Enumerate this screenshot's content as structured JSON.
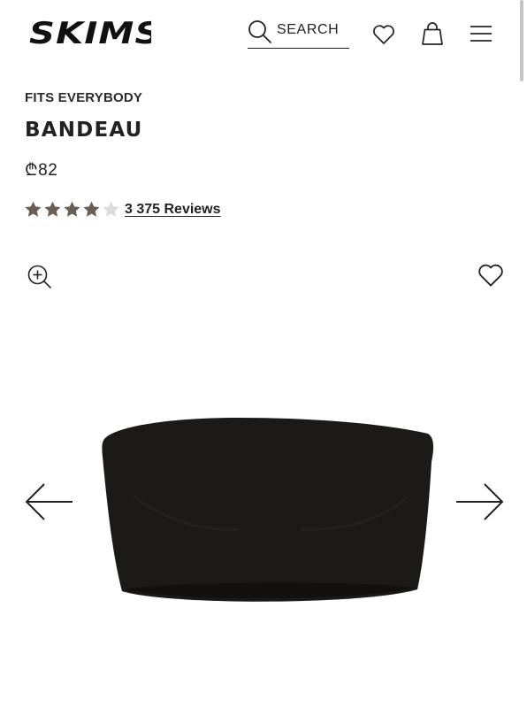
{
  "brand": {
    "logo_text": "SKIMS"
  },
  "header": {
    "search_label": "SEARCH",
    "icons": [
      "search-icon",
      "heart-icon",
      "bag-icon",
      "menu-icon"
    ]
  },
  "product": {
    "collection": "FITS EVERYBODY",
    "name": "BANDEAU",
    "price": "₾82",
    "rating": {
      "value": 4.5,
      "max": 5,
      "reviews_label": "3 375 Reviews"
    },
    "image_alt_icons": [
      "zoom-in-icon",
      "wishlist-heart-icon",
      "arrow-left-icon",
      "arrow-right-icon"
    ]
  },
  "colors": {
    "text": "#222222",
    "star_filled": "#6b5f54",
    "star_empty": "#dcdcdc",
    "product": "#1c1a19"
  }
}
